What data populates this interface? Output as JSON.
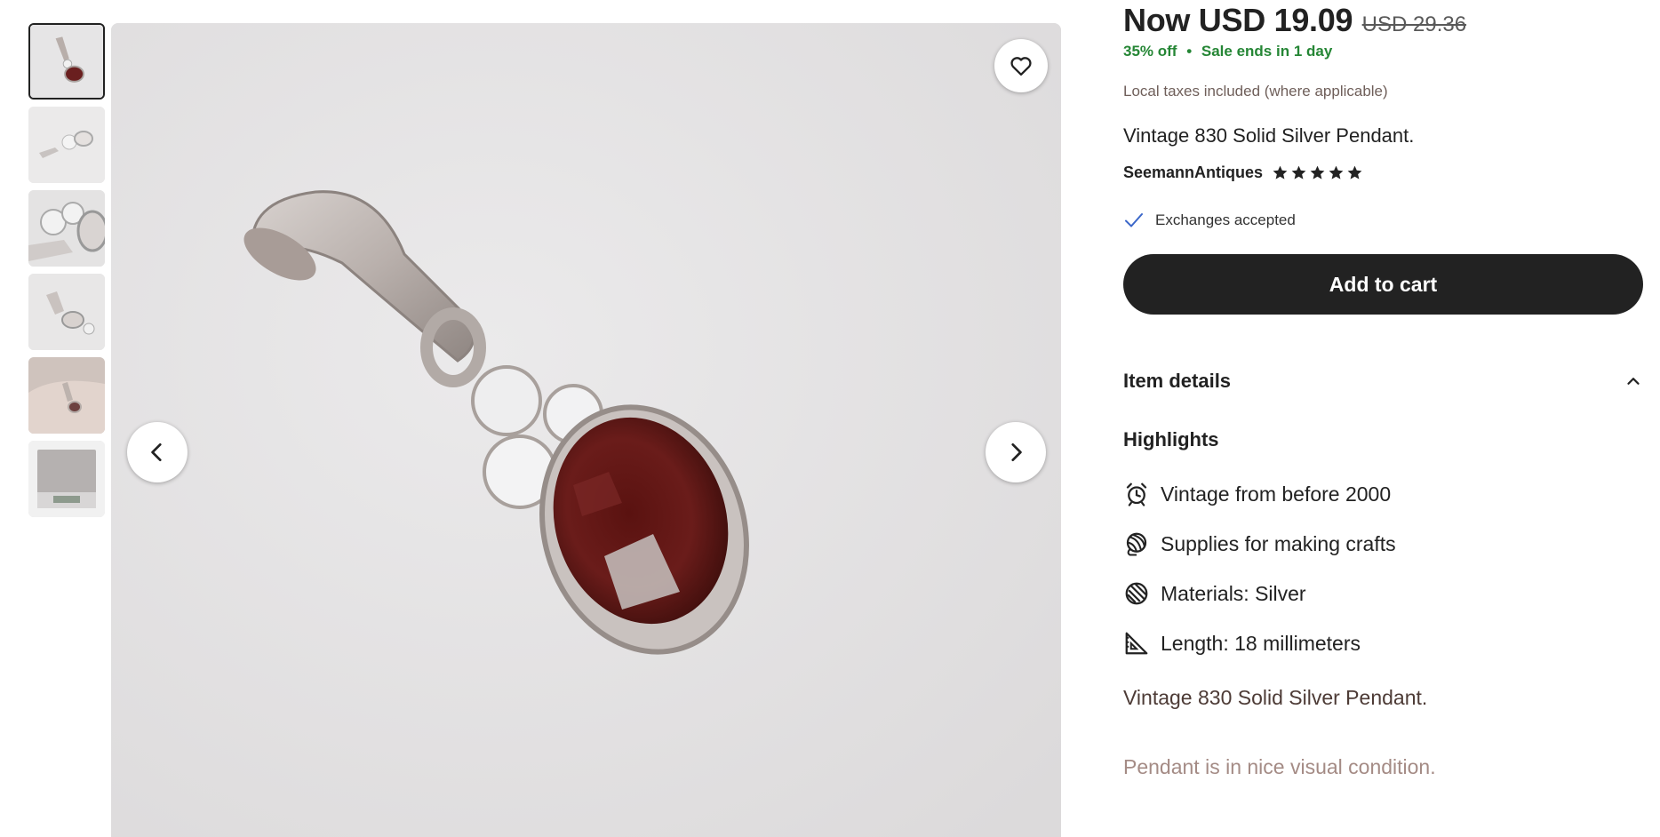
{
  "gallery": {
    "thumbnails": [
      {
        "label": "pendant front view"
      },
      {
        "label": "pendant side view"
      },
      {
        "label": "pendant detail close-up"
      },
      {
        "label": "pendant back view"
      },
      {
        "label": "pendant in hand"
      },
      {
        "label": "pendant on scale"
      }
    ],
    "active_index": 0,
    "favorite_icon": "heart-icon",
    "prev_icon": "chevron-left-icon",
    "next_icon": "chevron-right-icon"
  },
  "price": {
    "now": "Now USD 19.09",
    "original": "USD 29.36",
    "discount": "35% off",
    "separator": "•",
    "sale_ends": "Sale ends in 1 day",
    "taxes": "Local taxes included (where applicable)"
  },
  "listing": {
    "title": "Vintage 830 Solid Silver Pendant.",
    "shop_name": "SeemannAntiques",
    "rating": 5,
    "exchanges": "Exchanges accepted"
  },
  "actions": {
    "add_to_cart": "Add to cart"
  },
  "details": {
    "heading": "Item details",
    "expand_icon": "chevron-up-icon",
    "highlights_heading": "Highlights",
    "highlights": [
      {
        "icon": "alarm-clock-icon",
        "text": "Vintage from before 2000"
      },
      {
        "icon": "yarn-ball-icon",
        "text": "Supplies for making crafts"
      },
      {
        "icon": "material-icon",
        "text": "Materials: Silver"
      },
      {
        "icon": "ruler-triangle-icon",
        "text": "Length: 18 millimeters"
      }
    ],
    "description_1": "Vintage 830 Solid Silver Pendant.",
    "description_2": "Pendant is in nice visual condition."
  },
  "colors": {
    "sale_green": "#258635",
    "button_dark": "#222222",
    "check_blue": "#3b67c9"
  }
}
